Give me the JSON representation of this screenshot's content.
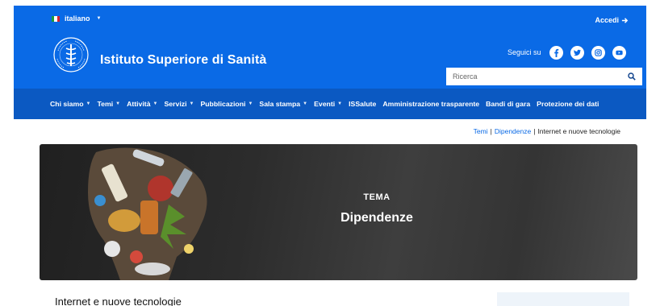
{
  "header": {
    "language": "italiano",
    "login_label": "Accedi",
    "org_name": "Istituto Superiore di Sanità",
    "follow_label": "Seguici su",
    "social": [
      "facebook-icon",
      "twitter-icon",
      "instagram-icon",
      "youtube-icon"
    ],
    "search_placeholder": "Ricerca"
  },
  "nav": [
    {
      "label": "Chi siamo",
      "dropdown": true
    },
    {
      "label": "Temi",
      "dropdown": true
    },
    {
      "label": "Attività",
      "dropdown": true
    },
    {
      "label": "Servizi",
      "dropdown": true
    },
    {
      "label": "Pubblicazioni",
      "dropdown": true
    },
    {
      "label": "Sala stampa",
      "dropdown": true
    },
    {
      "label": "Eventi",
      "dropdown": true
    },
    {
      "label": "ISSalute",
      "dropdown": false
    },
    {
      "label": "Amministrazione trasparente",
      "dropdown": false
    },
    {
      "label": "Bandi di gara",
      "dropdown": false
    },
    {
      "label": "Protezione dei dati",
      "dropdown": false
    }
  ],
  "breadcrumb": {
    "items": [
      "Temi",
      "Dipendenze"
    ],
    "separator": "|",
    "current": "Internet e nuove tecnologie"
  },
  "hero": {
    "kicker": "TEMA",
    "title": "Dipendenze"
  },
  "page": {
    "heading": "Internet e nuove tecnologie"
  },
  "colors": {
    "header_blue": "#0a6ae6",
    "nav_blue": "#0b59c2",
    "link_blue": "#0a6ae6"
  }
}
